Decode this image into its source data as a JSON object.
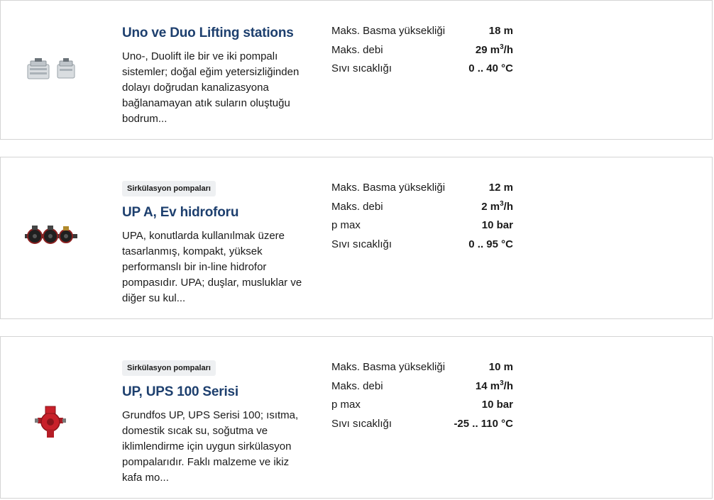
{
  "products": [
    {
      "image_icon": "lifting-station-icon",
      "badge": "",
      "title": "Uno ve Duo Lifting stations",
      "description": "Uno-, Duolift ile bir ve iki pompalı sistemler; doğal eğim yetersizliğinden dolayı doğrudan kanalizasyona bağlanamayan atık suların oluştuğu bodrum...",
      "specs": [
        {
          "label": "Maks. Basma yüksekliği",
          "value": "18 m"
        },
        {
          "label": "Maks. debi",
          "value_main": "29 m",
          "value_sup": "3",
          "value_tail": "/h"
        },
        {
          "label": "Sıvı sıcaklığı",
          "value": "0 .. 40 °C"
        }
      ]
    },
    {
      "image_icon": "circulator-pump-black-icon",
      "badge": "Sirkülasyon pompaları",
      "title": "UP A, Ev hidroforu",
      "description": "UPA, konutlarda kullanılmak üzere tasarlanmış, kompakt, yüksek performanslı bir in-line hidrofor pompasıdır. UPA; duşlar, musluklar ve diğer su kul...",
      "specs": [
        {
          "label": "Maks. Basma yüksekliği",
          "value": "12 m"
        },
        {
          "label": "Maks. debi",
          "value_main": "2 m",
          "value_sup": "3",
          "value_tail": "/h"
        },
        {
          "label": "p max",
          "value": "10 bar"
        },
        {
          "label": "Sıvı sıcaklığı",
          "value": "0 .. 95 °C"
        }
      ]
    },
    {
      "image_icon": "circulator-pump-red-icon",
      "badge": "Sirkülasyon pompaları",
      "title": "UP, UPS 100 Serisi",
      "description": "Grundfos UP, UPS Serisi 100; ısıtma, domestik sıcak su, soğutma ve iklimlendirme için uygun sirkülasyon pompalarıdır. Faklı malzeme ve ikiz kafa mo...",
      "specs": [
        {
          "label": "Maks. Basma yüksekliği",
          "value": "10 m"
        },
        {
          "label": "Maks. debi",
          "value_main": "14 m",
          "value_sup": "3",
          "value_tail": "/h"
        },
        {
          "label": "p max",
          "value": "10 bar"
        },
        {
          "label": "Sıvı sıcaklığı",
          "value": "-25 .. 110 °C"
        }
      ]
    }
  ],
  "colors": {
    "title": "#1d3f6e",
    "border": "#d4d4d4",
    "badge_bg": "#eef0f2",
    "pump_red": "#c8202a"
  }
}
